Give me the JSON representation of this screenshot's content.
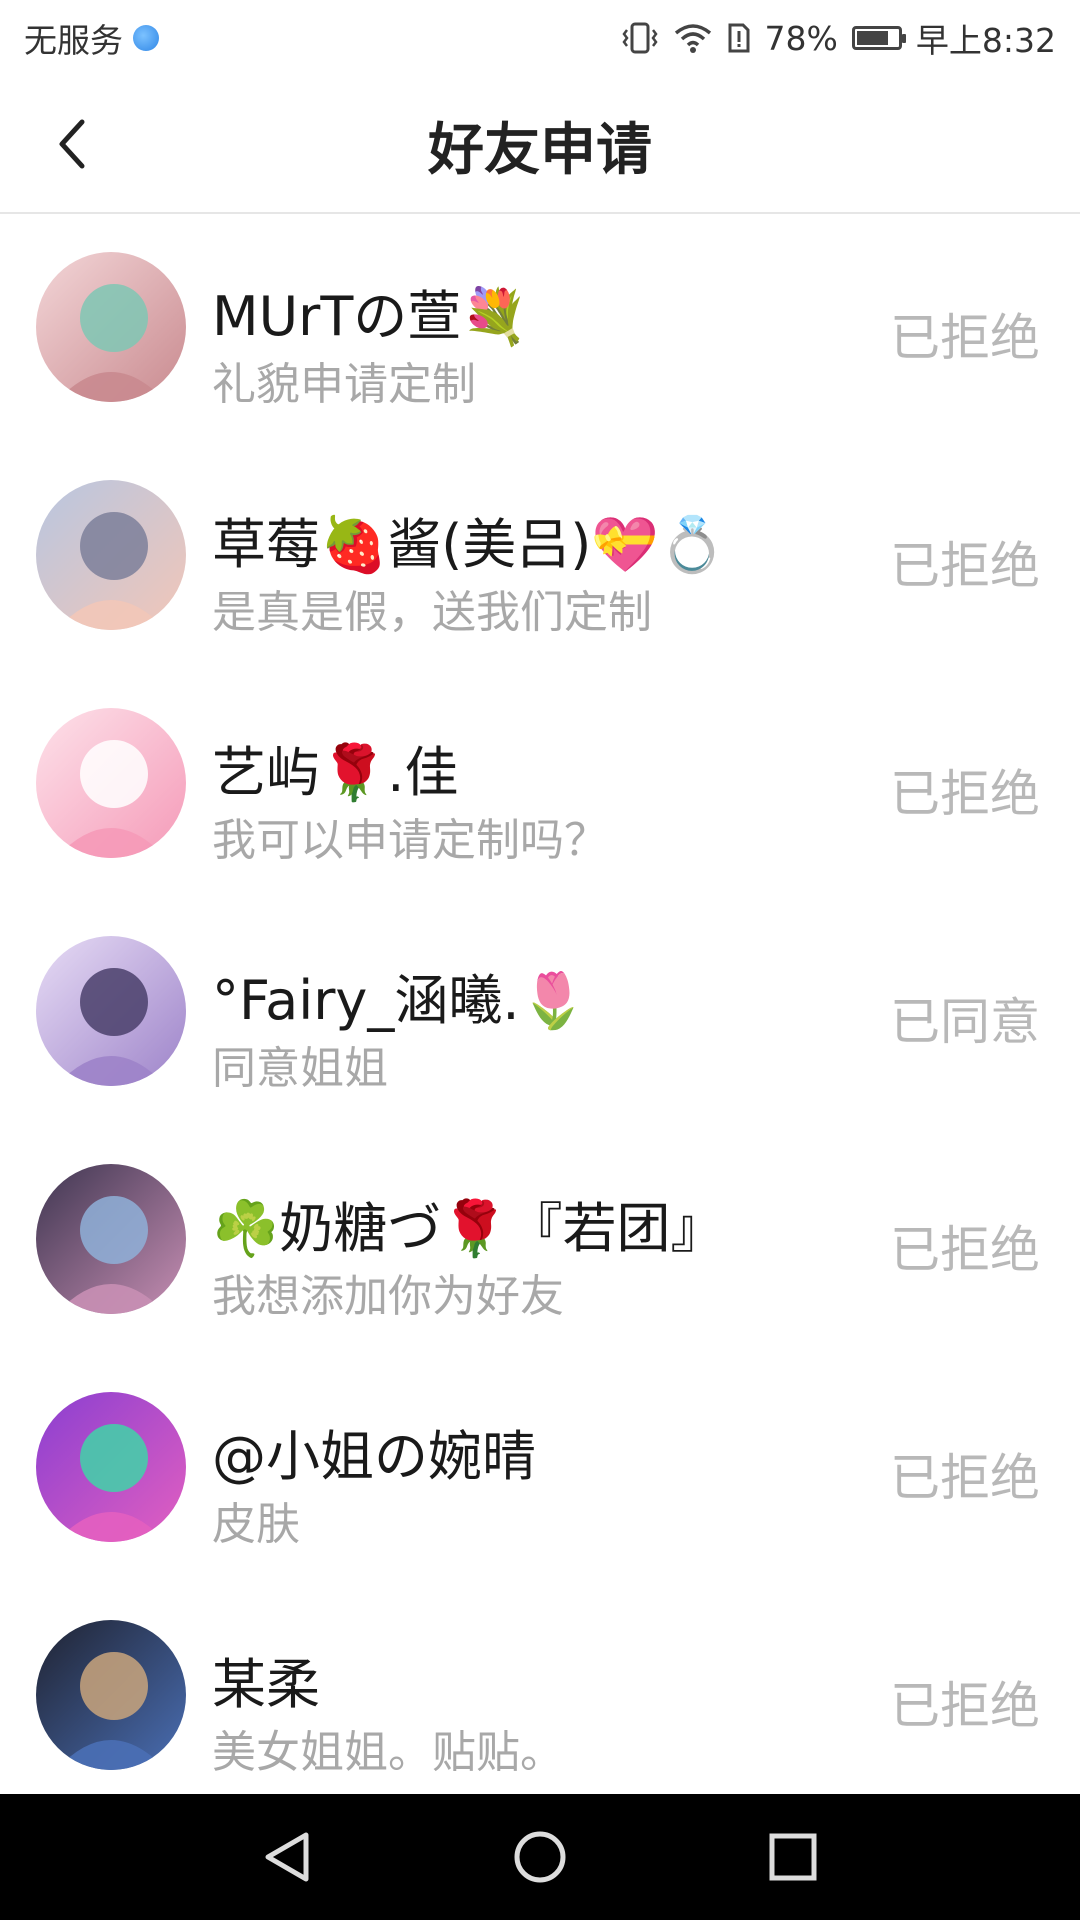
{
  "status_bar": {
    "carrier": "无服务",
    "battery": "78%",
    "battery_level": 0.78,
    "time": "早上8:32",
    "icons": [
      "vpn-icon",
      "vibrate-icon",
      "wifi-icon",
      "sim-alert-icon",
      "battery-icon"
    ]
  },
  "header": {
    "title": "好友申请",
    "back_icon": "chevron-left-icon"
  },
  "requests": [
    {
      "name": "MUrTの萱💐",
      "message": "礼貌申请定制",
      "status": "已拒绝",
      "avatar_colors": [
        "#f3d6d8",
        "#c98a8f",
        "#7fc7b4"
      ]
    },
    {
      "name": "草莓🍓酱(美吕)💝💍",
      "message": "是真是假，送我们定制",
      "status": "已拒绝",
      "avatar_colors": [
        "#b8c6e0",
        "#f2c6b8",
        "#7d7f9a"
      ]
    },
    {
      "name": "艺屿🌹.佳",
      "message": "我可以申请定制吗？",
      "status": "已拒绝",
      "avatar_colors": [
        "#fde2ea",
        "#f59ab8",
        "#ffffff"
      ]
    },
    {
      "name": "°Fairy_涵曦.🌷",
      "message": "同意姐姐",
      "status": "已同意",
      "avatar_colors": [
        "#e7dcf5",
        "#9d83c9",
        "#4a3f6b"
      ]
    },
    {
      "name": "☘️奶糖づ🌹『若团』",
      "message": "我想添加你为好友",
      "status": "已拒绝",
      "avatar_colors": [
        "#3d3550",
        "#c88fb4",
        "#8fb0d8"
      ]
    },
    {
      "name": "@小姐の婉晴",
      "message": "皮肤",
      "status": "已拒绝",
      "avatar_colors": [
        "#8a3fd1",
        "#e35fc0",
        "#3fd4a8"
      ]
    },
    {
      "name": "某柔",
      "message": "美女姐姐。贴贴。",
      "status": "已拒绝",
      "avatar_colors": [
        "#1f2230",
        "#4a6fb5",
        "#c9a47d"
      ]
    }
  ],
  "nav_bar": {
    "icons": [
      "back-triangle-icon",
      "home-circle-icon",
      "recents-square-icon"
    ]
  }
}
